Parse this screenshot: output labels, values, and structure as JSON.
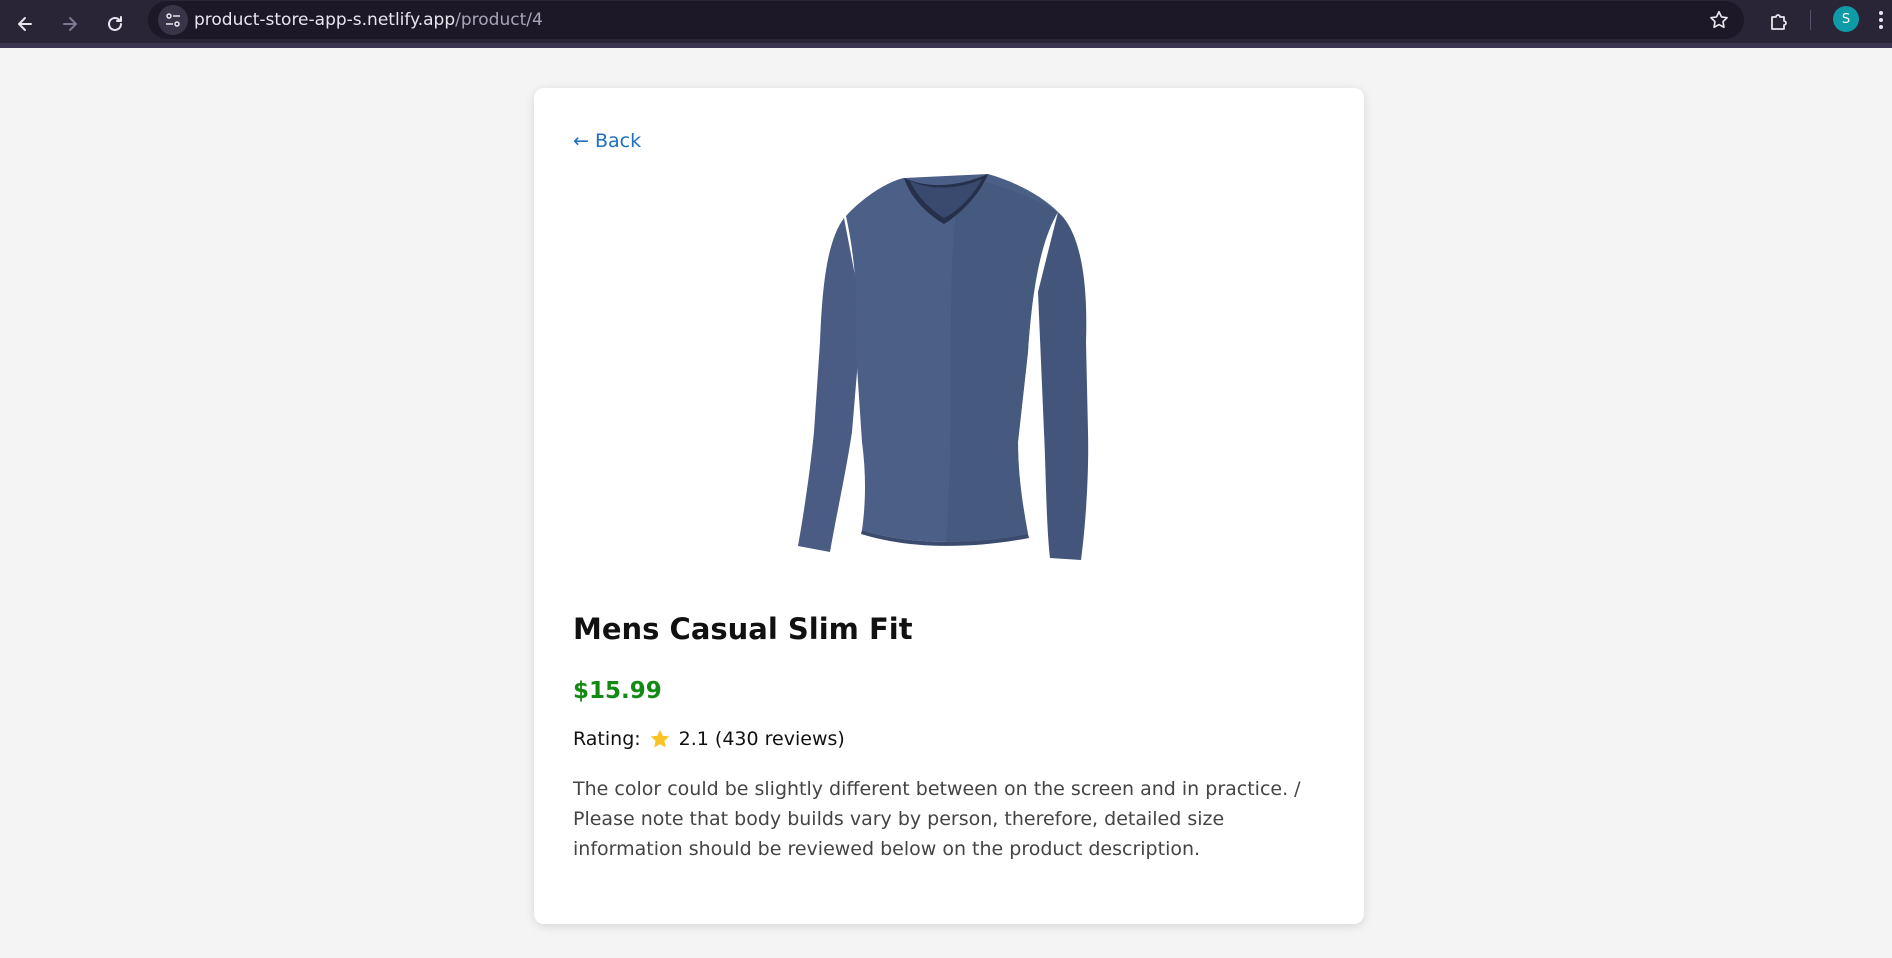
{
  "browser": {
    "url_host": "product-store-app-s.netlify.app",
    "url_path": "/product/4",
    "profile_initial": "S"
  },
  "page": {
    "back_label": "← Back",
    "product": {
      "title": "Mens Casual Slim Fit",
      "price": "$15.99",
      "rating_label": "Rating:",
      "rating_value": "2.1 (430 reviews)",
      "description": "The color could be slightly different between on the screen and in practice. / Please note that body builds vary by person, therefore, detailed size information should be reviewed below on the product description.",
      "image_icon": "long-sleeve-shirt"
    }
  },
  "colors": {
    "chrome_bg": "#2a2437",
    "page_bg": "#f4f4f4",
    "link": "#1f6fbf",
    "price": "#138a13",
    "star": "#f7c325",
    "shirt": "#4c5f86"
  }
}
